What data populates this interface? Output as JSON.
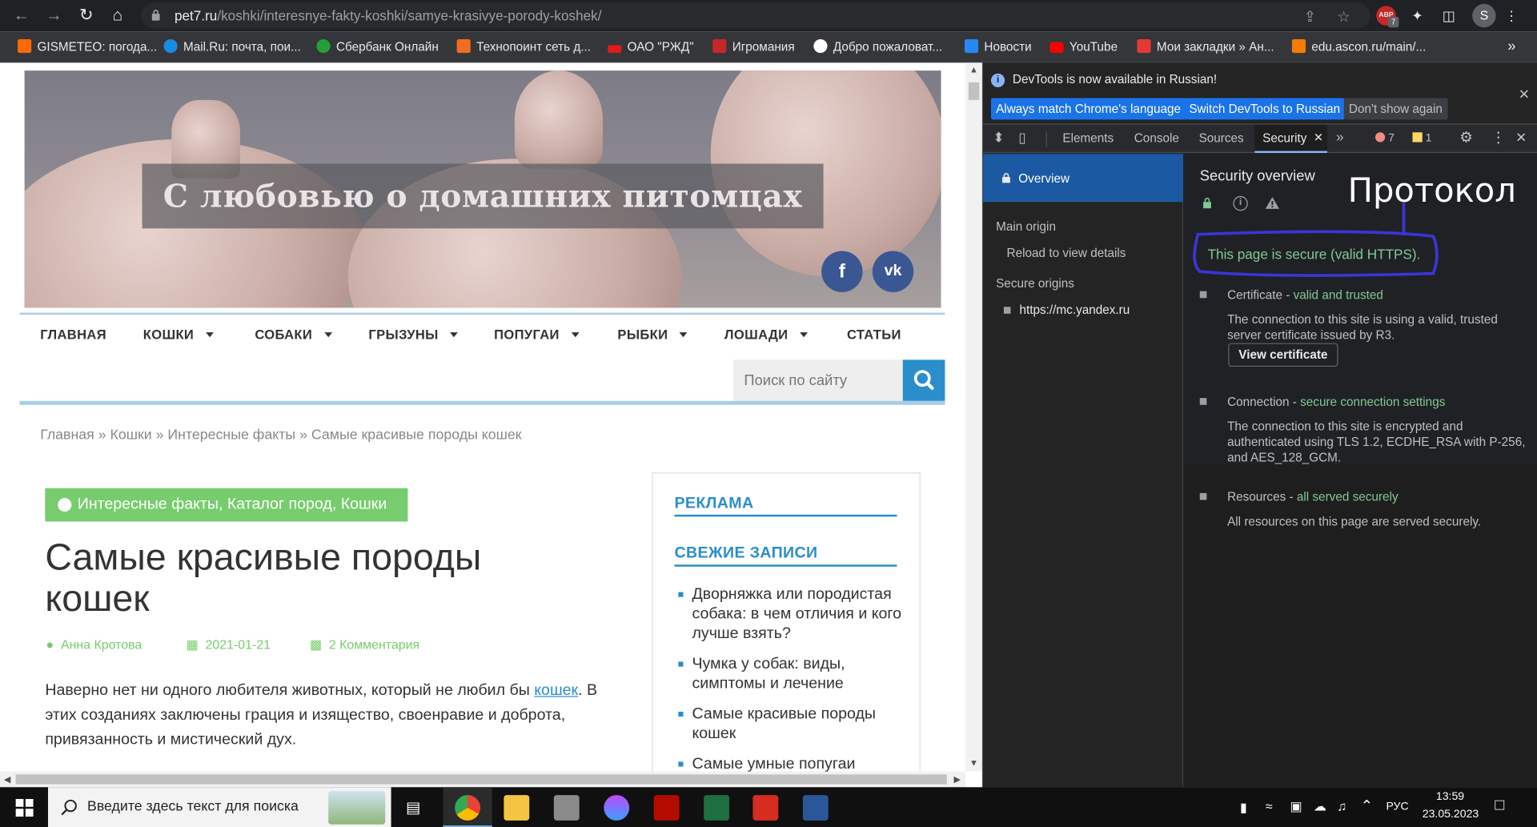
{
  "browser": {
    "url_host": "pet7.ru",
    "url_path": "/koshki/interesnye-fakty-koshki/samye-krasivye-porody-koshek/",
    "avatar": "S",
    "ext_badge": "7",
    "ext_label": "ABP"
  },
  "bookmarks": [
    {
      "label": "GISMETEO: погода...",
      "color": "#ff6a00"
    },
    {
      "label": "Mail.Ru: почта, пои...",
      "color": "#168de2"
    },
    {
      "label": "Сбербанк Онлайн",
      "color": "#21a038"
    },
    {
      "label": "Технопоинт сеть д...",
      "color": "#f26d21"
    },
    {
      "label": "ОАО \"РЖД\"",
      "color": "#e21a1a"
    },
    {
      "label": "Игромания",
      "color": "#c62828"
    },
    {
      "label": "Добро пожаловат...",
      "color": "#ffffff"
    },
    {
      "label": "Новости",
      "color": "#2787f5"
    },
    {
      "label": "YouTube",
      "color": "#ff0000"
    },
    {
      "label": "Мои закладки » Ан...",
      "color": "#e53935"
    },
    {
      "label": "edu.ascon.ru/main/...",
      "color": "#f57c00"
    }
  ],
  "site": {
    "hero_title": "С любовью о домашних питомцах",
    "fb": "f",
    "vk": "vk",
    "menu": [
      {
        "label": "ГЛАВНАЯ",
        "caret": false
      },
      {
        "label": "КОШКИ",
        "caret": true
      },
      {
        "label": "СОБАКИ",
        "caret": true
      },
      {
        "label": "ГРЫЗУНЫ",
        "caret": true
      },
      {
        "label": "ПОПУГАИ",
        "caret": true
      },
      {
        "label": "РЫБКИ",
        "caret": true
      },
      {
        "label": "ЛОШАДИ",
        "caret": true
      },
      {
        "label": "СТАТЬИ",
        "caret": false
      }
    ],
    "search_placeholder": "Поиск по сайту",
    "breadcrumb": "Главная » Кошки » Интересные факты » Самые красивые породы кошек",
    "categories": "Интересные факты, Каталог пород, Кошки",
    "title": "Самые красивые породы кошек",
    "author": "Анна Кротова",
    "date": "2021-01-21",
    "comments": "2 Комментария",
    "para_before": "Наверно нет ни одного любителя животных, который не любил бы ",
    "para_link": "кошек",
    "para_after": ". В этих созданиях заключены грация и изящество, своенравие и доброта, привязанность и мистический дух.",
    "sidebar": {
      "ads_heading": "РЕКЛАМА",
      "recent_heading": "СВЕЖИЕ ЗАПИСИ",
      "posts": [
        "Дворняжка или породистая собака: в чем отличия и кого лучше взять?",
        "Чумка у собак: виды, симптомы и лечение",
        "Самые красивые породы кошек",
        "Самые умные попугаи"
      ]
    }
  },
  "devtools": {
    "info_text": "DevTools is now available in Russian!",
    "btn_match": "Always match Chrome's language",
    "btn_switch": "Switch DevTools to Russian",
    "btn_dont": "Don't show again",
    "tabs": [
      "Elements",
      "Console",
      "Sources",
      "Security"
    ],
    "errors": "7",
    "warnings": "1",
    "left": {
      "overview": "Overview",
      "main_origin": "Main origin",
      "reload": "Reload to view details",
      "secure_origins": "Secure origins",
      "origin_1": "https://mc.yandex.ru"
    },
    "right": {
      "title": "Security overview",
      "secure_msg": "This page is secure (valid HTTPS).",
      "cert_label": "Certificate - ",
      "cert_status": "valid and trusted",
      "cert_desc": "The connection to this site is using a valid, trusted server certificate issued by R3.",
      "view_cert": "View certificate",
      "conn_label": "Connection - ",
      "conn_status": "secure connection settings",
      "conn_desc": "The connection to this site is encrypted and authenticated using TLS 1.2, ECDHE_RSA with P-256, and AES_128_GCM.",
      "res_label": "Resources - ",
      "res_status": "all served securely",
      "res_desc": "All resources on this page are served securely."
    },
    "annotation": "Протокол"
  },
  "taskbar": {
    "search_placeholder": "Введите здесь текст для поиска",
    "lang": "РУС",
    "time": "13:59",
    "date": "23.05.2023"
  }
}
